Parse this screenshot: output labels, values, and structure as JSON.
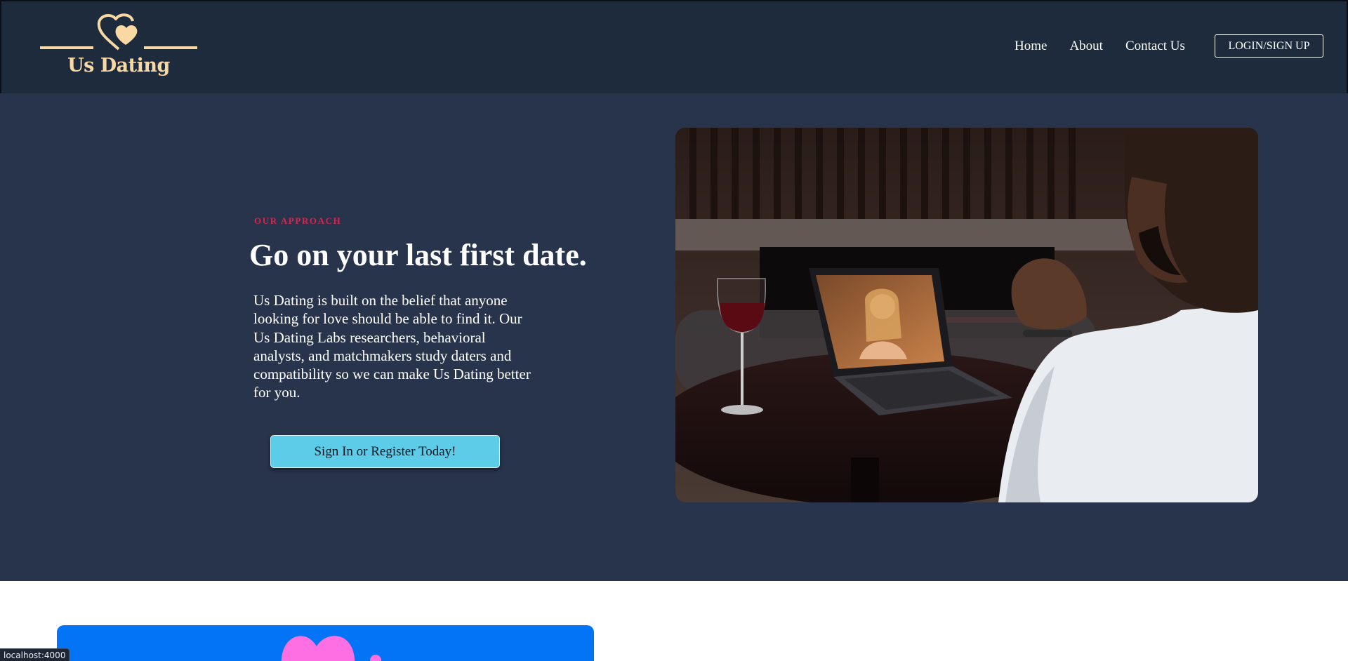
{
  "header": {
    "brand": "Us Dating",
    "nav": [
      {
        "label": "Home"
      },
      {
        "label": "About"
      },
      {
        "label": "Contact Us"
      }
    ],
    "login_label": "LOGIN/SIGN UP"
  },
  "hero": {
    "eyebrow": "OUR APPROACH",
    "title": "Go on your last first date.",
    "body": "Us Dating is built on the belief that anyone looking for love should be able to find it. Our Us Dating Labs researchers, behavioral analysts, and matchmakers study daters and compatibility so we can make Us Dating better for you.",
    "cta_label": "Sign In or Register Today!"
  },
  "status_bar": {
    "url": "localhost:4000"
  },
  "colors": {
    "header_bg": "#1e2b3c",
    "hero_bg": "#28334c",
    "brand_gold": "#f8d9a3",
    "eyebrow_red": "#e0204d",
    "cta_bg": "#5ccce9",
    "card_blue": "#0474f6",
    "heart_pink": "#ff6fe4"
  },
  "icons": {
    "logo": "double-heart-icon"
  }
}
